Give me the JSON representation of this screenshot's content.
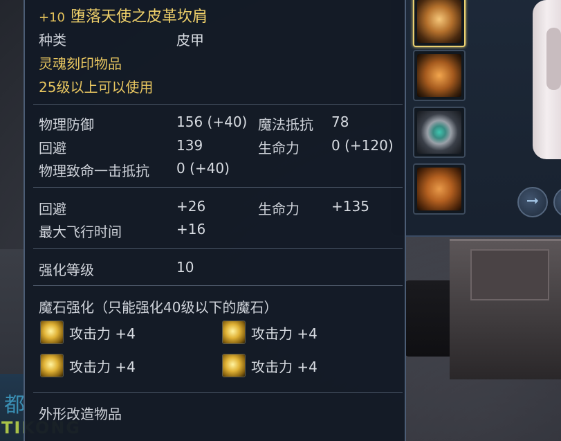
{
  "tooltip": {
    "title_plus": "+10",
    "title_name": "堕落天使之皮革坎肩",
    "type_label": "种类",
    "type_value": "皮甲",
    "soul_bound": "灵魂刻印物品",
    "level_req": "25级以上可以使用",
    "stats": {
      "phys_def_label": "物理防御",
      "phys_def_value": "156 (+40)",
      "magic_res_label": "魔法抵抗",
      "magic_res_value": "78",
      "evasion_label": "回避",
      "evasion_value": "139",
      "hp_label": "生命力",
      "hp_value": "0 (+120)",
      "crit_res_label": "物理致命一击抵抗",
      "crit_res_value": "0 (+40)"
    },
    "bonus": {
      "evasion_label": "回避",
      "evasion_value": "+26",
      "hp_label": "生命力",
      "hp_value": "+135",
      "flight_label": "最大飞行时间",
      "flight_value": "+16"
    },
    "enhance_label": "强化等级",
    "enhance_value": "10",
    "manastone_header": "魔石强化（只能强化40级以下的魔石）",
    "manastones": [
      {
        "text": "攻击力 +4"
      },
      {
        "text": "攻击力 +4"
      },
      {
        "text": "攻击力 +4"
      },
      {
        "text": "攻击力 +4"
      }
    ],
    "appearance": "外形改造物品"
  },
  "background": {
    "watermark_line1": "都",
    "watermark_line2": "TIKONG"
  },
  "colors": {
    "title": "#f0d16a",
    "text": "#d3d7de",
    "panel_bg": "#131a25",
    "border": "#4c5d75"
  },
  "icons": {
    "slot1": "shoulder-armor-icon",
    "slot2": "chest-armor-icon",
    "slot3": "ring-icon",
    "slot4": "boots-icon",
    "gem": "manastone-icon"
  }
}
